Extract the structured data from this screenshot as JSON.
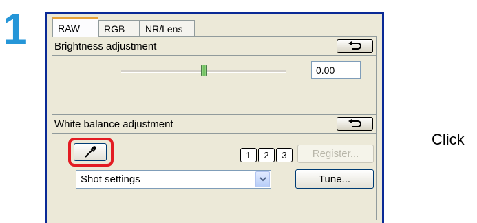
{
  "step": {
    "number": "1"
  },
  "tabs": [
    {
      "label": "RAW",
      "active": true
    },
    {
      "label": "RGB",
      "active": false
    },
    {
      "label": "NR/Lens",
      "active": false
    }
  ],
  "brightness": {
    "title": "Brightness adjustment",
    "reset_icon": "undo-arrow-icon",
    "value": "0.00",
    "slider_position": 0.5
  },
  "white_balance": {
    "title": "White balance adjustment",
    "reset_icon": "undo-arrow-icon",
    "eyedropper_icon": "eyedropper-icon",
    "presets": [
      "1",
      "2",
      "3"
    ],
    "register_label": "Register...",
    "register_enabled": false,
    "select_value": "Shot settings",
    "tune_label": "Tune..."
  },
  "callout": {
    "text": "Click"
  },
  "colors": {
    "step_number": "#2596d8",
    "highlight": "#e31c23",
    "window_frame": "#0a2a96",
    "panel_bg": "#ece9d8",
    "active_tab_accent": "#e7a239"
  }
}
